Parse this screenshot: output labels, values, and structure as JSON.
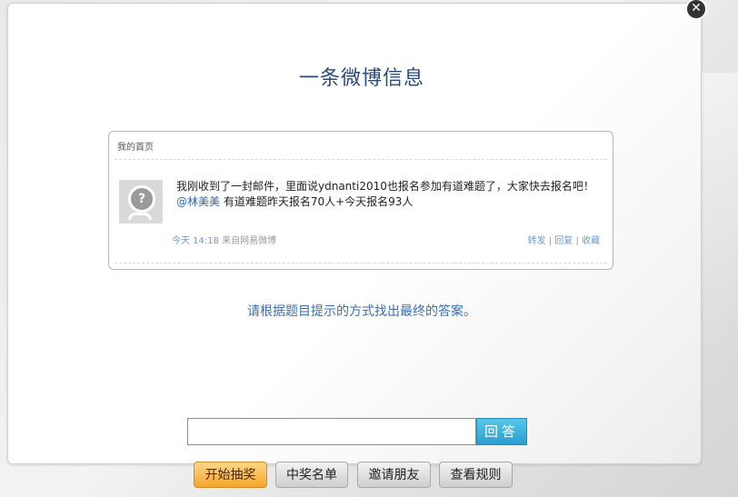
{
  "title": "一条微博信息",
  "weibo": {
    "header": "我的首页",
    "text_before_mention": "我刚收到了一封邮件，里面说ydnanti2010也报名参加有道难题了，大家快去报名吧！",
    "mention": "@林美美",
    "text_after_mention": " 有道难题昨天报名70人+今天报名93人",
    "time": "今天 14:18",
    "source": " 来自网易微博",
    "actions": {
      "forward": "转发",
      "reply": "回复",
      "favorite": "收藏",
      "separator": " | "
    },
    "avatar_icon": "default-avatar-icon"
  },
  "hint": "请根据题目提示的方式找出最终的答案。",
  "answer": {
    "value": "",
    "placeholder": "",
    "button_label": "回答"
  },
  "buttons": {
    "start": "开始抽奖",
    "winners": "中奖名单",
    "invite": "邀请朋友",
    "rules": "查看规则"
  },
  "close_icon": "close-icon",
  "colors": {
    "title": "#2b4a7c",
    "link": "#2a66b6",
    "accent_button": "#2b9fd0",
    "start_button": "#f6a62a"
  }
}
